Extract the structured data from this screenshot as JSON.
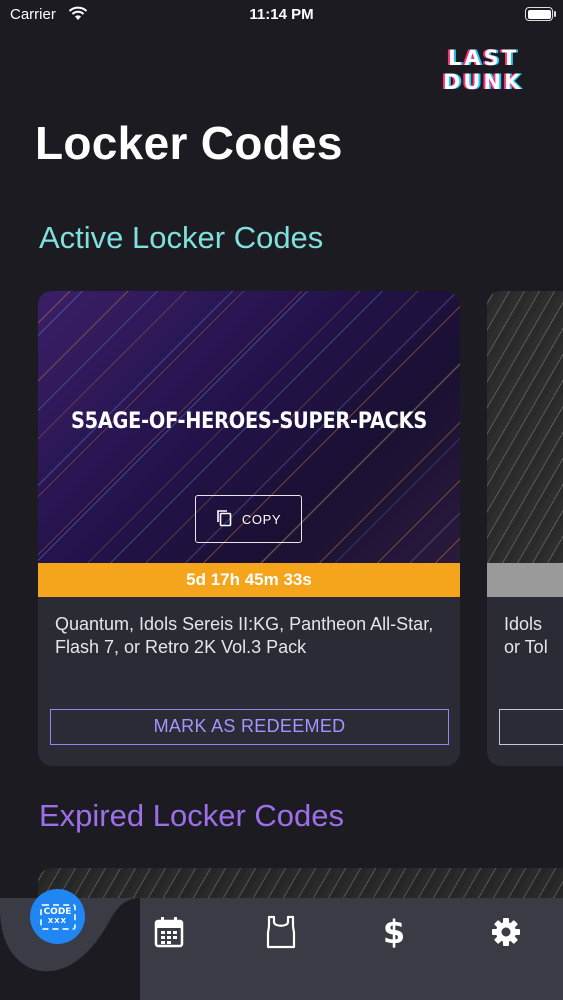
{
  "status_bar": {
    "carrier": "Carrier",
    "time": "11:14 PM"
  },
  "logo": {
    "line1": "LAST",
    "line2": "DUNK"
  },
  "page_title": "Locker Codes",
  "sections": {
    "active_title": "Active Locker Codes",
    "expired_title": "Expired Locker Codes"
  },
  "active_codes": [
    {
      "code": "S5AGE-OF-HEROES-SUPER-PACKS",
      "copy_label": "COPY",
      "timer": "5d 17h 45m 33s",
      "description": "Quantum, Idols Sereis II:KG, Pantheon All-Star, Flash 7, or Retro 2K Vol.3 Pack",
      "redeem_label": "MARK AS REDEEMED"
    },
    {
      "description_partial": "Idols\nor Tol"
    }
  ],
  "tabbar": {
    "items": [
      "code-tab",
      "calendar-tab",
      "jersey-tab",
      "dollar-tab",
      "settings-tab"
    ],
    "code_badge_top": "CODE",
    "code_badge_bottom": "XXX"
  },
  "colors": {
    "background": "#1b1b21",
    "active_title": "#7fe0dd",
    "expired_title": "#9d6fe8",
    "timer_bar": "#f4a51c",
    "redeem_border": "#8f86f0",
    "tab_active": "#1f86f4"
  }
}
